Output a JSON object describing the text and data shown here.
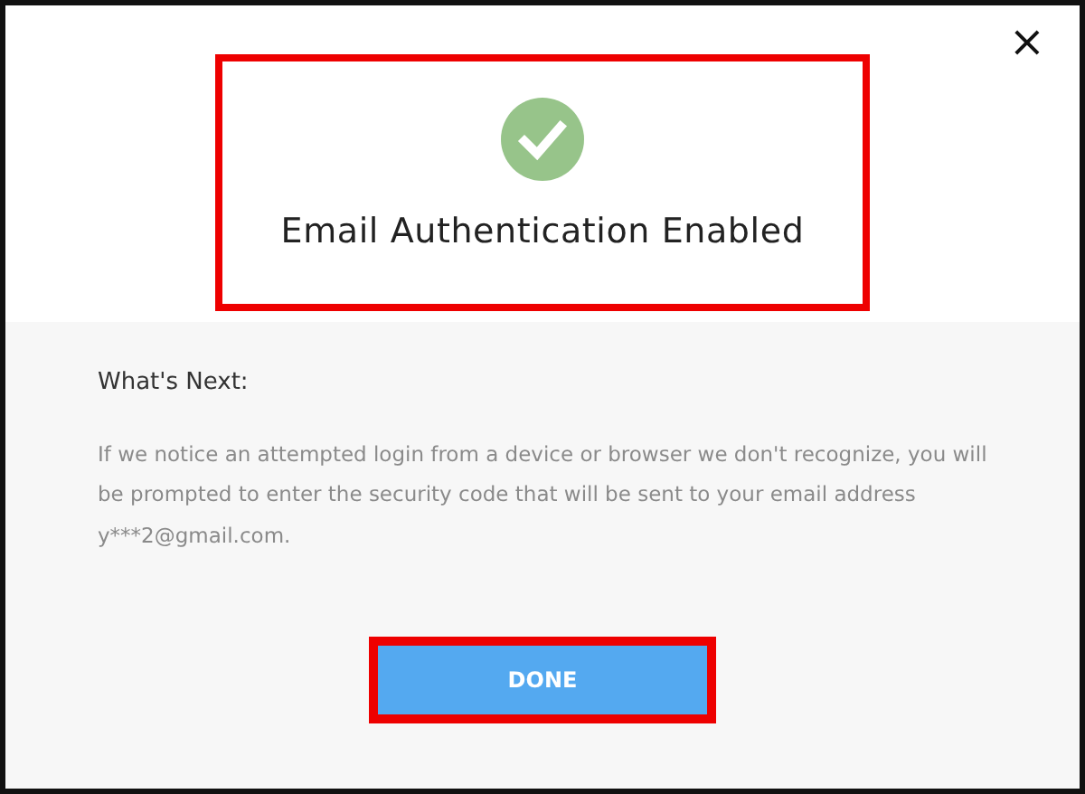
{
  "dialog": {
    "close_label": "×",
    "header": {
      "title": "Email Authentication Enabled",
      "highlighted": true
    },
    "section_title": "What's Next:",
    "message": "If we notice an attempted login from a device or browser we don't recognize, you will be prompted to enter the security code that will be sent to your email address y***2@gmail.com.",
    "button": {
      "label": "DONE",
      "highlighted": true
    }
  }
}
